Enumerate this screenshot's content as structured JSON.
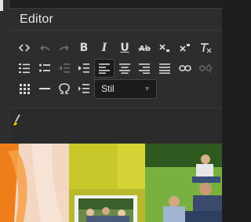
{
  "editor": {
    "title": "Editor",
    "styles_select": {
      "value": "Stil"
    }
  },
  "toolbar": {
    "row1": [
      "source-code-icon",
      "undo-icon",
      "redo-icon",
      "bold",
      "italic",
      "underline",
      "strikethrough-icon",
      "subscript-icon",
      "superscript-icon",
      "remove-format-icon"
    ],
    "bold_label": "B",
    "italic_label": "I",
    "underline_label": "U",
    "row2": [
      "numbered-list-icon",
      "bulleted-list-icon",
      "decrease-indent-icon",
      "increase-indent-icon",
      "align-left-icon",
      "align-center-icon",
      "align-right-icon",
      "justify-icon",
      "link-icon",
      "unlink-icon"
    ],
    "row3": [
      "table-icon",
      "horizontal-line-icon",
      "special-character-icon",
      "page-break-icon"
    ]
  },
  "colors": {
    "panel": "#2d2d2d",
    "icon": "#d8d8d8",
    "icon_disabled": "#6a6a6a",
    "brush_accent": "#e8c400"
  }
}
